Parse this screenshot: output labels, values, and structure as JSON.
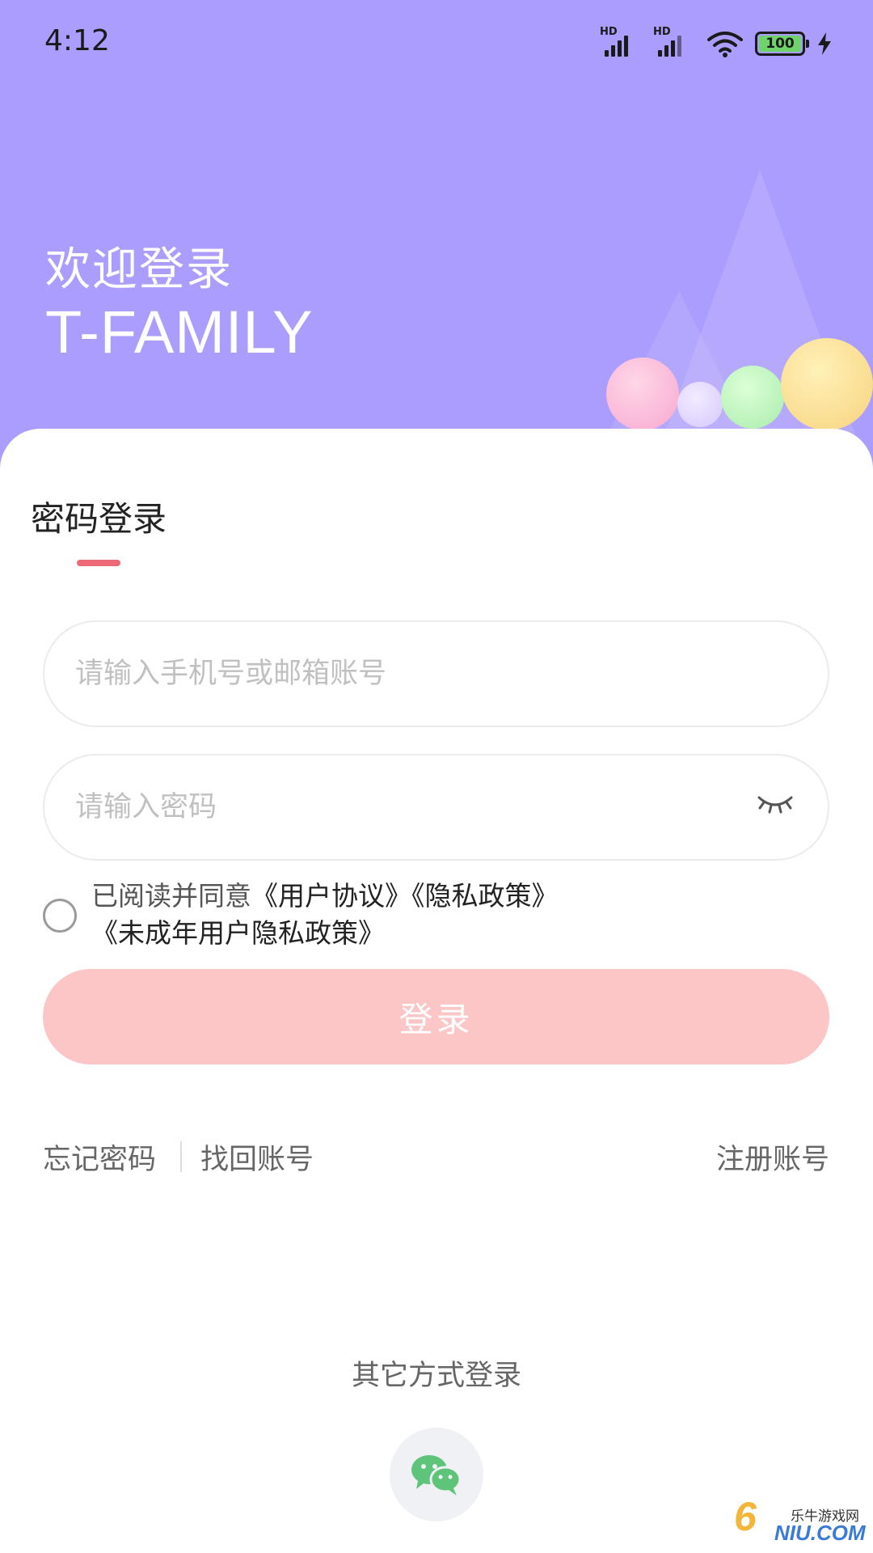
{
  "status_bar": {
    "time": "4:12",
    "sim1_tag": "HD",
    "sim2_tag": "HD",
    "battery_level": "100"
  },
  "header": {
    "welcome": "欢迎登录",
    "brand": "T-FAMILY"
  },
  "login_form": {
    "tab_title": "密码登录",
    "account_placeholder": "请输入手机号或邮箱账号",
    "password_placeholder": "请输入密码",
    "agreement": {
      "prefix": "已阅读并同意",
      "user_agreement": "《用户协议》",
      "privacy_policy": "《隐私政策》",
      "minor_privacy_policy": "《未成年用户隐私政策》"
    },
    "submit_label": "登录"
  },
  "links": {
    "forgot_password": "忘记密码",
    "recover_account": "找回账号",
    "register": "注册账号"
  },
  "other_login": {
    "label": "其它方式登录",
    "methods": [
      "wechat-icon"
    ]
  },
  "watermark": {
    "name": "乐牛游戏网",
    "domain": "NIU.COM",
    "digit": "6"
  },
  "colors": {
    "header_bg": "#ab9dfd",
    "accent_underline": "#ec6a78",
    "login_button": "#fcc5c6",
    "wechat_green": "#5ec47a"
  }
}
